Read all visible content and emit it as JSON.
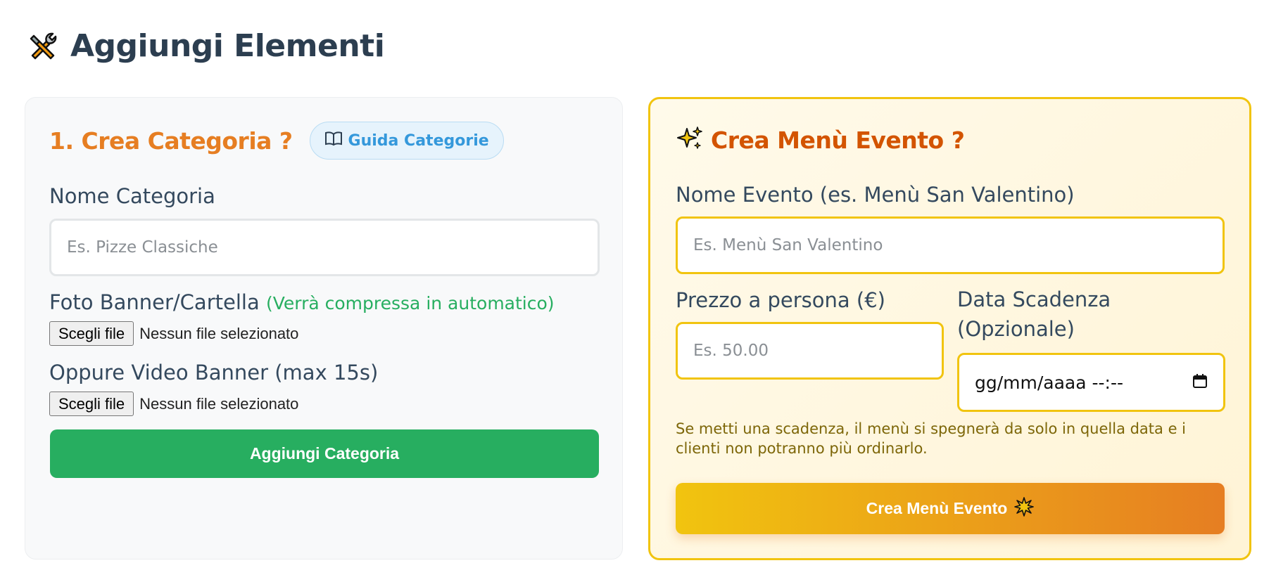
{
  "header": {
    "title": "Aggiungi Elementi",
    "icon": "tools-icon"
  },
  "category_section": {
    "title": "1. Crea Categoria ?",
    "guide_button": "Guida Categorie",
    "name_label": "Nome Categoria",
    "name_placeholder": "Es. Pizze Classiche",
    "photo_label": "Foto Banner/Cartella",
    "photo_hint": "(Verrà compressa in automatico)",
    "photo_file_button": "Scegli file",
    "photo_file_status": "Nessun file selezionato",
    "video_label": "Oppure Video Banner (max 15s)",
    "video_file_button": "Scegli file",
    "video_file_status": "Nessun file selezionato",
    "submit_label": "Aggiungi Categoria"
  },
  "event_section": {
    "title": "Crea Menù Evento ?",
    "icon": "sparkles-icon",
    "name_label": "Nome Evento (es. Menù San Valentino)",
    "name_placeholder": "Es. Menù San Valentino",
    "price_label": "Prezzo a persona (€)",
    "price_placeholder": "Es. 50.00",
    "expiry_label_line1": "Data Scadenza",
    "expiry_label_line2": "(Opzionale)",
    "expiry_placeholder": "gg/mm/aaaa --:--",
    "note": "Se metti una scadenza, il menù si spegnerà da solo in quella data e i clienti non potranno più ordinarlo.",
    "submit_label": "Crea Menù Evento",
    "submit_icon": "sparkle-burst-icon"
  },
  "colors": {
    "title": "#2c3e50",
    "category_accent": "#e67e22",
    "event_accent": "#d35400",
    "event_border": "#f1c40f",
    "green_button": "#27ae60",
    "guide_blue": "#3498db",
    "hint_green": "#27ae60"
  }
}
